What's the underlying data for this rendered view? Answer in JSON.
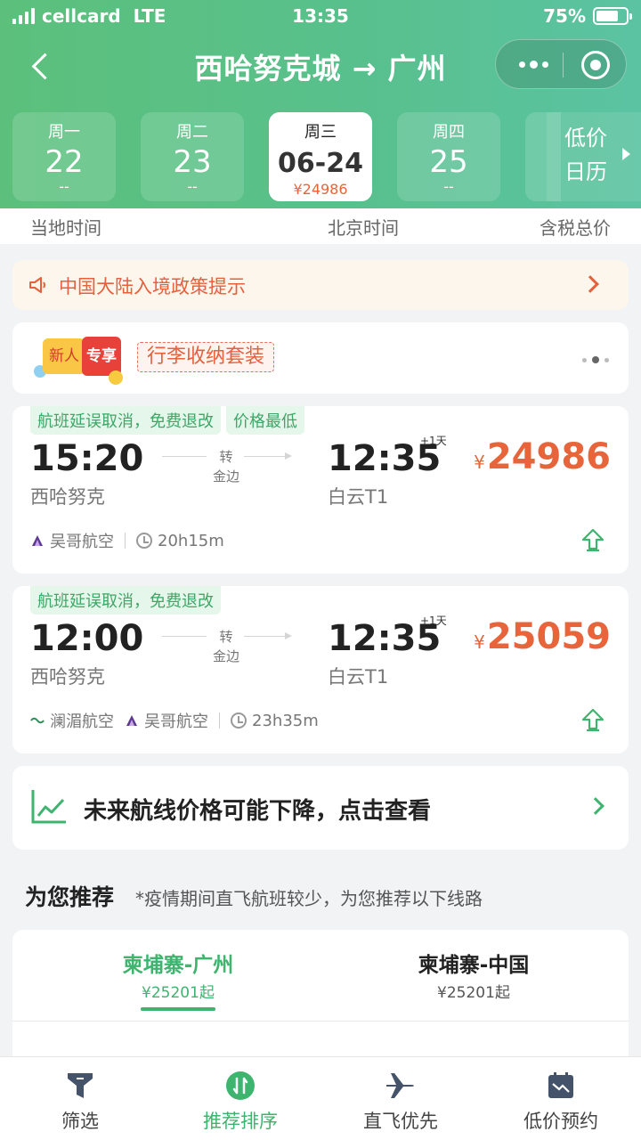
{
  "status_bar": {
    "carrier": "cellcard",
    "network": "LTE",
    "time": "13:35",
    "battery": "75%"
  },
  "nav": {
    "title": "西哈努克城 → 广州"
  },
  "dates": [
    {
      "weekday": "周一",
      "day": "22",
      "price": "--",
      "active": false
    },
    {
      "weekday": "周二",
      "day": "23",
      "price": "--",
      "active": false
    },
    {
      "weekday": "周三",
      "day": "06-24",
      "price": "¥24986",
      "active": true
    },
    {
      "weekday": "周四",
      "day": "25",
      "price": "--",
      "active": false
    }
  ],
  "calendar": {
    "line1": "低价",
    "line2": "日历"
  },
  "column_header": {
    "local": "当地时间",
    "beijing": "北京时间",
    "total": "含税总价"
  },
  "policy": {
    "text": "中国大陆入境政策提示"
  },
  "promo": {
    "badge_left": "新人",
    "badge_right": "专享",
    "tag": "行李收纳套装"
  },
  "flights": [
    {
      "tags": [
        "航班延误取消，免费退改",
        "价格最低"
      ],
      "dep_time": "15:20",
      "dep_airport": "西哈努克",
      "via_label": "转",
      "via_city": "金边",
      "arr_time": "12:35",
      "arr_plus": "+1天",
      "arr_airport": "白云T1",
      "price_symbol": "¥",
      "price": "24986",
      "airlines": [
        "吴哥航空"
      ],
      "duration": "20h15m"
    },
    {
      "tags": [
        "航班延误取消，免费退改"
      ],
      "dep_time": "12:00",
      "dep_airport": "西哈努克",
      "via_label": "转",
      "via_city": "金边",
      "arr_time": "12:35",
      "arr_plus": "+1天",
      "arr_airport": "白云T1",
      "price_symbol": "¥",
      "price": "25059",
      "airlines": [
        "澜湄航空",
        "吴哥航空"
      ],
      "duration": "23h35m"
    }
  ],
  "trend": {
    "text": "未来航线价格可能下降，点击查看"
  },
  "recommend": {
    "title": "为您推荐",
    "subtitle": "*疫情期间直飞航班较少，为您推荐以下线路",
    "tabs": [
      {
        "name": "柬埔寨-广州",
        "price": "¥25201起",
        "active": true
      },
      {
        "name": "柬埔寨-中国",
        "price": "¥25201起",
        "active": false
      }
    ]
  },
  "tabbar": [
    {
      "label": "筛选",
      "icon": "filter-icon",
      "active": false
    },
    {
      "label": "推荐排序",
      "icon": "sort-icon",
      "active": true
    },
    {
      "label": "直飞优先",
      "icon": "plane-icon",
      "active": false
    },
    {
      "label": "低价预约",
      "icon": "price-alert-icon",
      "active": false
    }
  ],
  "colors": {
    "brand_green": "#3eb46e",
    "price_orange": "#e8643a",
    "header_green": "#5cc07c"
  }
}
